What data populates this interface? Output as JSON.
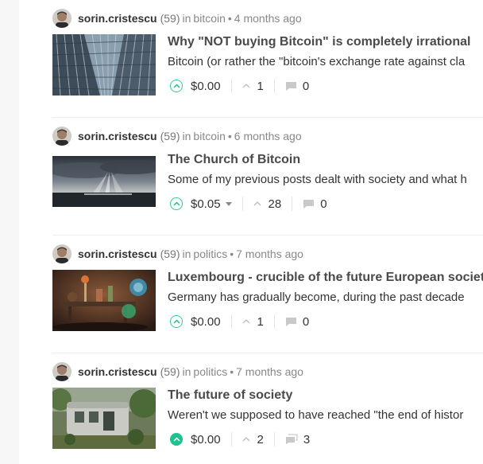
{
  "colors": {
    "accent": "#1fc28e",
    "muted": "#888888"
  },
  "posts": [
    {
      "author": "sorin.cristescu",
      "reputation": "(59)",
      "in_label": "in",
      "community": "bitcoin",
      "bullet": "•",
      "time": "4 months ago",
      "title": "Why \"NOT buying Bitcoin\" is completely irrational",
      "body": "Bitcoin (or rather the \"bitcoin's exchange rate against cla",
      "payout": "$0.00",
      "votes": "1",
      "comments": "0",
      "image": "glass-skyscraper"
    },
    {
      "author": "sorin.cristescu",
      "reputation": "(59)",
      "in_label": "in",
      "community": "bitcoin",
      "bullet": "•",
      "time": "6 months ago",
      "title": "The Church of Bitcoin",
      "body": "Some of my previous posts dealt with society and what h",
      "payout": "$0.05",
      "votes": "28",
      "comments": "0",
      "image": "sunrays-over-sea"
    },
    {
      "author": "sorin.cristescu",
      "reputation": "(59)",
      "in_label": "in",
      "community": "politics",
      "bullet": "•",
      "time": "7 months ago",
      "title": "Luxembourg - crucible of the future European societ",
      "body": "Germany has gradually become, during the past decade",
      "payout": "$0.00",
      "votes": "1",
      "comments": "0",
      "image": "alchemy-flasks"
    },
    {
      "author": "sorin.cristescu",
      "reputation": "(59)",
      "in_label": "in",
      "community": "politics",
      "bullet": "•",
      "time": "7 months ago",
      "title": "The future of society",
      "body": "Weren't we supposed to have reached \"the end of histor",
      "payout": "$0.00",
      "votes": "2",
      "comments": "3",
      "image": "abandoned-caravan"
    }
  ]
}
